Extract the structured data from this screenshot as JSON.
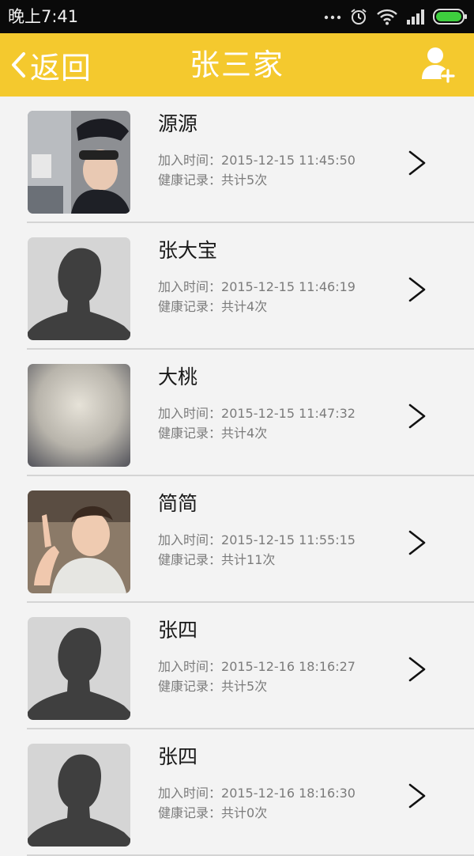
{
  "status_bar": {
    "time": "晚上7:41",
    "icons": [
      "more-dots-icon",
      "alarm-icon",
      "wifi-icon",
      "signal-icon",
      "battery-icon"
    ]
  },
  "header": {
    "back_label": "返回",
    "title": "张三家",
    "add_icon": "add-user-icon",
    "background_color": "#f4c92e"
  },
  "list": {
    "join_prefix": "加入时间：",
    "record_prefix": "健康记录：",
    "items": [
      {
        "name": "源源",
        "join_time": "2015-12-15 11:45:50",
        "records": "共计5次",
        "avatar": "photo-boy-cap"
      },
      {
        "name": "张大宝",
        "join_time": "2015-12-15 11:46:19",
        "records": "共计4次",
        "avatar": "default-silhouette"
      },
      {
        "name": "大桃",
        "join_time": "2015-12-15 11:47:32",
        "records": "共计4次",
        "avatar": "photo-grey-texture"
      },
      {
        "name": "简简",
        "join_time": "2015-12-15 11:55:15",
        "records": "共计11次",
        "avatar": "photo-boy-pointing"
      },
      {
        "name": "张四",
        "join_time": "2015-12-16 18:16:27",
        "records": "共计5次",
        "avatar": "default-silhouette"
      },
      {
        "name": "张四",
        "join_time": "2015-12-16 18:16:30",
        "records": "共计0次",
        "avatar": "default-silhouette"
      }
    ]
  }
}
